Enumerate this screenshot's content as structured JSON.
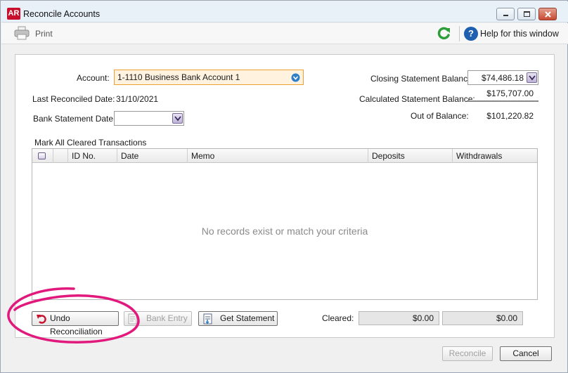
{
  "window": {
    "logo": "AR",
    "title": "Reconcile Accounts"
  },
  "toolbar": {
    "print_label": "Print",
    "help_label": "Help for this window",
    "help_mark": "?"
  },
  "form": {
    "account_label": "Account:",
    "account_value": "1-1110 Business Bank Account 1",
    "last_reconciled_label": "Last Reconciled Date:",
    "last_reconciled_value": "31/10/2021",
    "bank_statement_label": "Bank Statement Date:",
    "bank_statement_value": "",
    "closing_label": "Closing Statement Balance:",
    "closing_value": "$74,486.18",
    "calculated_label": "Calculated Statement Balance:",
    "calculated_value": "$175,707.00",
    "out_label": "Out of Balance:",
    "out_value": "$101,220.82"
  },
  "table": {
    "mark_all_label": "Mark All Cleared Transactions",
    "columns": [
      "",
      "ID No.",
      "Date",
      "Memo",
      "Deposits",
      "Withdrawals"
    ],
    "empty_message": "No records exist or match your criteria"
  },
  "actions": {
    "undo_label": "Undo Reconciliation",
    "bank_entry_label": "Bank Entry",
    "get_statement_label": "Get Statement",
    "cleared_label": "Cleared:",
    "cleared_deposits": "$0.00",
    "cleared_withdrawals": "$0.00"
  },
  "footer": {
    "reconcile_label": "Reconcile",
    "cancel_label": "Cancel"
  },
  "colors": {
    "highlight_circle": "#e2197c",
    "account_field_bg": "#fff3e0",
    "account_field_border": "#f0a030",
    "logo_bg": "#c8102e"
  }
}
